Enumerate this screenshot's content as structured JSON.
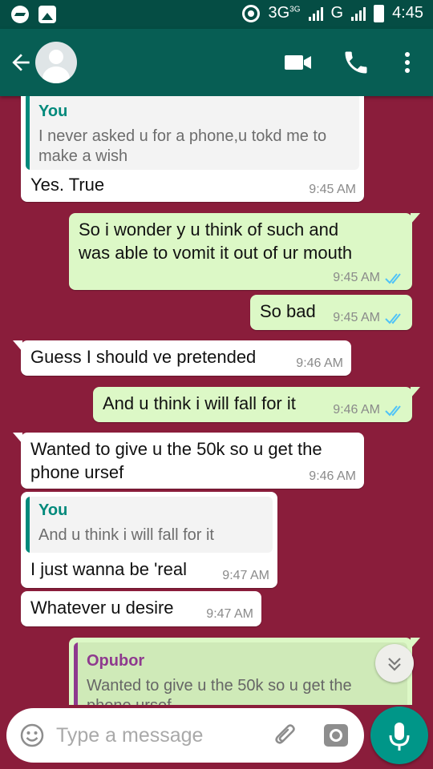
{
  "status_bar": {
    "network": "3G",
    "network_sup": "3G",
    "carrier_g": "G",
    "time": "4:45"
  },
  "composer": {
    "placeholder": "Type a message"
  },
  "messages": [
    {
      "dir": "in",
      "quote_name": "You",
      "quote_text": [
        "I never asked u for a phone,u tokd me to",
        "make a wish"
      ],
      "text": [
        "Yes. True"
      ],
      "time": "9:45 AM"
    },
    {
      "dir": "out",
      "text": [
        "So  i wonder y u think of such and",
        "was able to vomit it out of ur mouth"
      ],
      "time": "9:45 AM",
      "status": "read"
    },
    {
      "dir": "out",
      "text": [
        "So bad"
      ],
      "time": "9:45 AM",
      "status": "read"
    },
    {
      "dir": "in",
      "text": [
        "Guess I should ve pretended"
      ],
      "time": "9:46 AM"
    },
    {
      "dir": "out",
      "text": [
        "And u think i will fall for it"
      ],
      "time": "9:46 AM",
      "status": "read"
    },
    {
      "dir": "in",
      "text": [
        "Wanted to give u the 50k so u get the",
        "phone ursef"
      ],
      "time": "9:46 AM"
    },
    {
      "dir": "in",
      "quote_name": "You",
      "quote_text": [
        "And u think i will fall for it"
      ],
      "text": [
        "I just wanna be 'real"
      ],
      "time": "9:47 AM"
    },
    {
      "dir": "in",
      "text": [
        "Whatever u desire"
      ],
      "time": "9:47 AM"
    },
    {
      "dir": "out",
      "quote_name": "Opubor",
      "quote_text": [
        "Wanted to give u the 50k so u get the",
        "phone ursef"
      ]
    }
  ],
  "colors": {
    "chat_background": "#8a1d3b",
    "header": "#075e54",
    "outgoing_bubble": "#dcf8c6",
    "incoming_bubble": "#ffffff",
    "read_ticks": "#4fc3f7",
    "quote_you": "#00897b",
    "quote_opubor": "#8e3a8e",
    "mic_button": "#009688"
  },
  "icons": [
    "messenger-icon",
    "gallery-icon",
    "location-icon",
    "back-arrow-icon",
    "video-call-icon",
    "phone-icon",
    "more-vert-icon",
    "double-check-icon",
    "emoji-icon",
    "paperclip-icon",
    "camera-icon",
    "mic-icon",
    "chevron-down-icon"
  ]
}
